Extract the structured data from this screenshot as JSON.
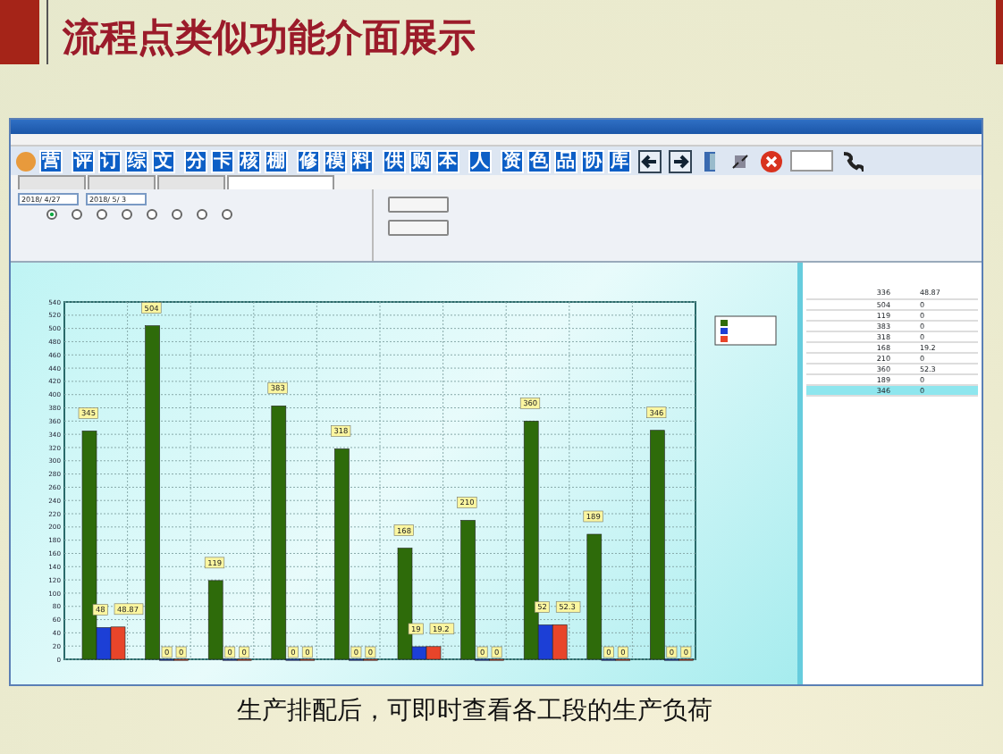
{
  "slide_title": "流程点类似功能介面展示",
  "toolbar": {
    "buttons": [
      "营",
      "评",
      "订",
      "综",
      "文",
      "分",
      "卡",
      "核",
      "棚",
      "修",
      "模",
      "料",
      "供",
      "购",
      "本",
      "人",
      "资",
      "色",
      "品",
      "协",
      "库"
    ]
  },
  "tabs": [
    {
      "selected": false
    },
    {
      "selected": false
    },
    {
      "selected": false
    },
    {
      "selected": true
    }
  ],
  "filter": {
    "date_from": "2018/ 4/27",
    "date_to": "2018/ 5/ 3",
    "radios": [
      {
        "checked": true
      },
      {
        "checked": false
      },
      {
        "checked": false
      },
      {
        "checked": false
      },
      {
        "checked": false
      },
      {
        "checked": false
      },
      {
        "checked": false
      },
      {
        "checked": false
      }
    ]
  },
  "chart": {
    "chart_data": {
      "type": "bar",
      "grid": true,
      "ylim": [
        0,
        540
      ],
      "yticks": [
        0,
        20,
        40,
        60,
        80,
        100,
        120,
        140,
        160,
        180,
        200,
        220,
        240,
        260,
        280,
        300,
        320,
        340,
        360,
        380,
        400,
        420,
        440,
        460,
        480,
        500,
        520,
        540
      ],
      "data_labels": true,
      "series": [
        {
          "color": "#2e6b0a",
          "values": [
            345,
            504,
            119,
            383,
            318,
            168,
            210,
            360,
            189,
            346
          ]
        },
        {
          "color": "#1c3fd6",
          "values": [
            48,
            0,
            0,
            0,
            0,
            19,
            0,
            52,
            0,
            0
          ]
        },
        {
          "color": "#e8452a",
          "values": [
            48.87,
            0,
            0,
            0,
            0,
            19.2,
            0,
            52.3,
            0,
            0
          ]
        }
      ]
    }
  },
  "table": {
    "rows": [
      {
        "load": "336",
        "done": "48.87",
        "selected": false
      },
      {
        "load": "504",
        "done": "0",
        "selected": false
      },
      {
        "load": "119",
        "done": "0",
        "selected": false
      },
      {
        "load": "383",
        "done": "0",
        "selected": false
      },
      {
        "load": "318",
        "done": "0",
        "selected": false
      },
      {
        "load": "168",
        "done": "19.2",
        "selected": false
      },
      {
        "load": "210",
        "done": "0",
        "selected": false
      },
      {
        "load": "360",
        "done": "52.3",
        "selected": false
      },
      {
        "load": "189",
        "done": "0",
        "selected": false
      },
      {
        "load": "346",
        "done": "0",
        "selected": true
      }
    ]
  },
  "caption": "生产排配后，可即时查看各工段的生产负荷"
}
